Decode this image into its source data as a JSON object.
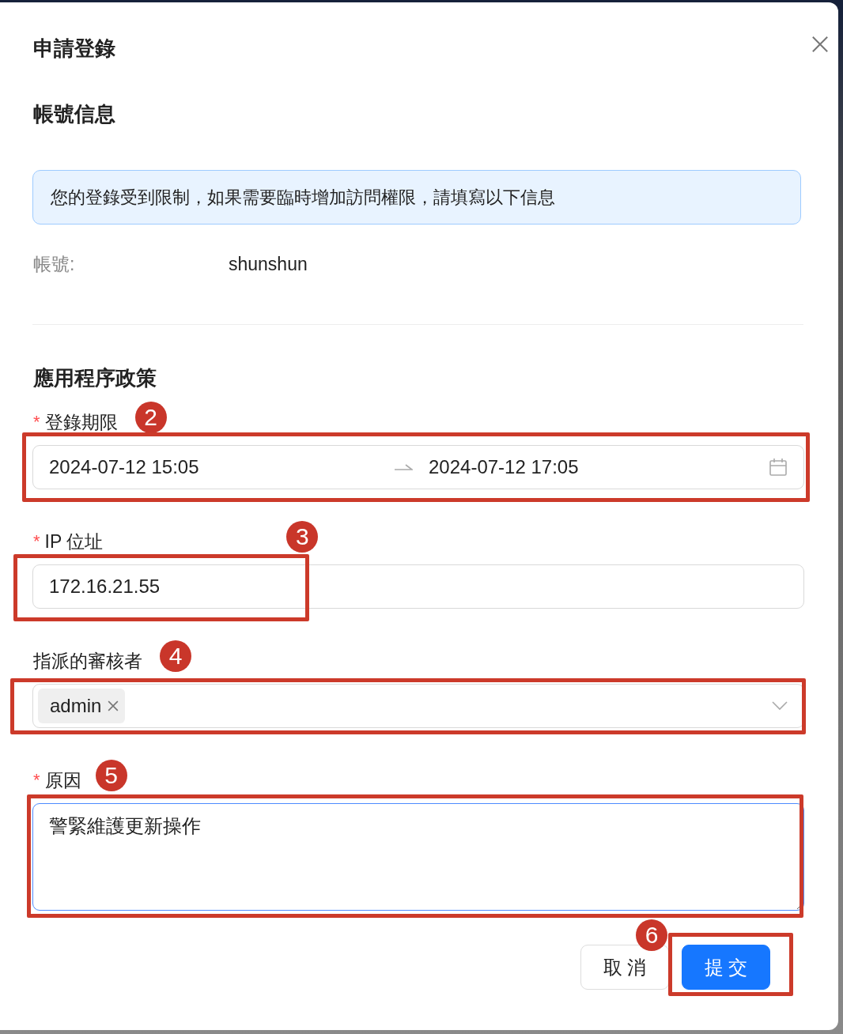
{
  "dialog": {
    "title": "申請登錄"
  },
  "account_section": {
    "heading": "帳號信息",
    "notice": "您的登錄受到限制，如果需要臨時增加訪問權限，請填寫以下信息",
    "account_label": "帳號:",
    "account_value": "shunshun"
  },
  "policy_section": {
    "heading": "應用程序政策",
    "fields": [
      {
        "kind": "daterange",
        "label": "登錄期限",
        "required_mark": "*",
        "start": "2024-07-12 15:05",
        "end": "2024-07-12 17:05",
        "annotation": "2"
      },
      {
        "kind": "text",
        "label": "IP 位址",
        "required_mark": "*",
        "value": "172.16.21.55",
        "annotation": "3"
      },
      {
        "kind": "tags",
        "label": "指派的審核者",
        "tags": [
          "admin"
        ],
        "annotation": "4"
      },
      {
        "kind": "textarea",
        "label": "原因",
        "required_mark": "*",
        "value": "警緊維護更新操作",
        "focused": true,
        "annotation": "5"
      }
    ]
  },
  "buttons": [
    {
      "label": "取 消",
      "primary": false
    },
    {
      "label": "提 交",
      "primary": true,
      "annotation": "6"
    }
  ]
}
